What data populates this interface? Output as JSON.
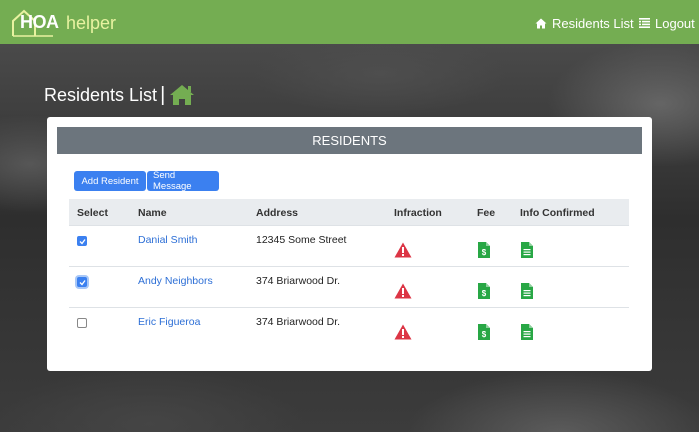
{
  "brand": {
    "bold": "HOA",
    "light": "helper"
  },
  "nav": {
    "residents_label": "Residents List",
    "logout_label": "Logout"
  },
  "page": {
    "title": "Residents List",
    "separator": "|"
  },
  "card": {
    "header": "RESIDENTS",
    "add_button": "Add Resident",
    "message_button": "Send Message"
  },
  "table": {
    "columns": [
      "Select",
      "Name",
      "Address",
      "Infraction",
      "Fee",
      "Info Confirmed"
    ],
    "rows": [
      {
        "selected": true,
        "name": "Danial Smith",
        "address": "12345 Some Street",
        "infraction_icon": "warning-icon",
        "fee_icon": "dollar-file-icon",
        "info_icon": "document-icon"
      },
      {
        "selected": true,
        "name": "Andy Neighbors",
        "address": "374 Briarwood Dr.",
        "infraction_icon": "warning-icon",
        "fee_icon": "dollar-file-icon",
        "info_icon": "document-icon"
      },
      {
        "selected": false,
        "name": "Eric Figueroa",
        "address": "374 Briarwood Dr.",
        "infraction_icon": "warning-icon",
        "fee_icon": "dollar-file-icon",
        "info_icon": "document-icon"
      }
    ]
  },
  "colors": {
    "navbar": "#74ad52",
    "primary": "#3b80f0",
    "header_gray": "#6c757d",
    "warning_red": "#dc3545",
    "fee_green": "#28a745"
  }
}
